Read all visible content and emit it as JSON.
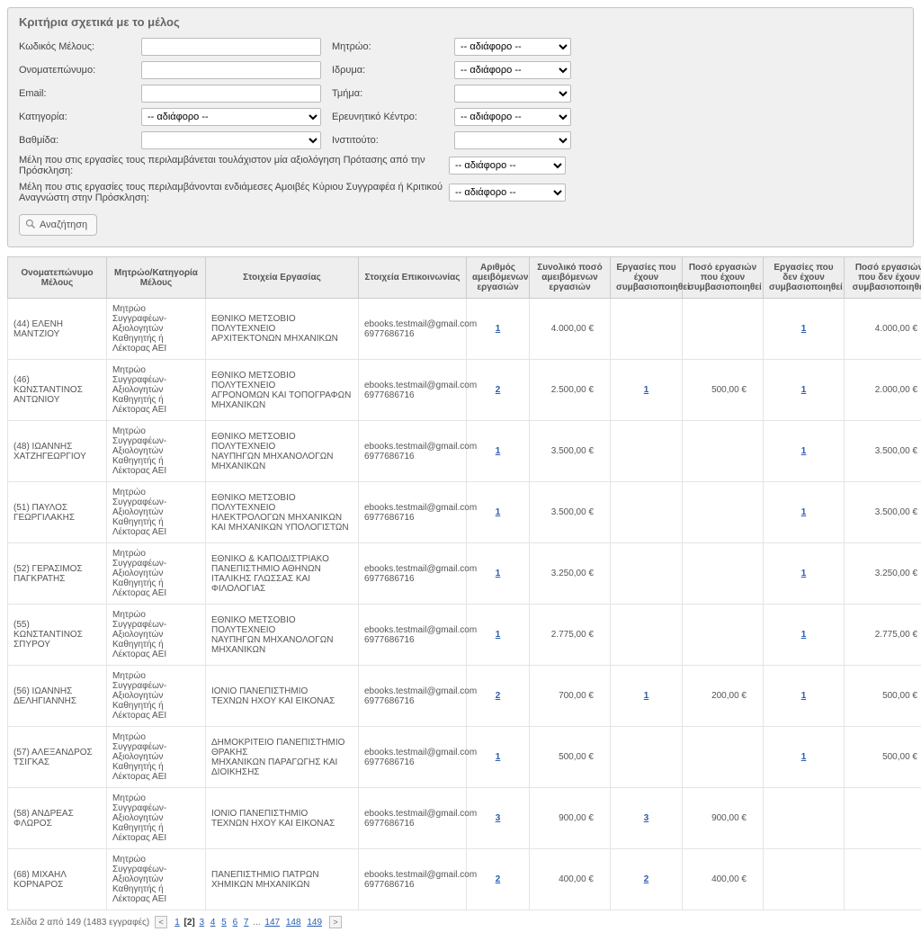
{
  "panel": {
    "title": "Κριτήρια σχετικά με το μέλος",
    "labels": {
      "member_code": "Κωδικός Μέλους:",
      "fullname": "Ονοματεπώνυμο:",
      "email": "Email:",
      "category": "Κατηγορία:",
      "rank": "Βαθμίδα:",
      "registry": "Μητρώο:",
      "institution": "Ιδρυμα:",
      "dept": "Τμήμα:",
      "research_center": "Ερευνητικό Κέντρο:",
      "institute": "Ινστιτούτο:",
      "long1": "Μέλη που στις εργασίες τους περιλαμβάνεται τουλάχιστον μία αξιολόγηση Πρότασης από την Πρόσκληση:",
      "long2": "Μέλη που στις εργασίες τους περιλαμβάνονται ενδιάμεσες Αμοιβές Κύριου Συγγραφέα ή Κριτικού Αναγνώστη στην Πρόσκληση:"
    },
    "ad": "-- αδιάφορο --",
    "search": "Αναζήτηση"
  },
  "headers": {
    "c1": "Ονοματεπώνυμο Μέλους",
    "c2": "Μητρώο/Κατηγορία Μέλους",
    "c3": "Στοιχεία Εργασίας",
    "c4": "Στοιχεία Επικοινωνίας",
    "c5": "Αριθμός αμειβόμενων εργασιών",
    "c6": "Συνολικό ποσό αμειβόμενων εργασιών",
    "c7": "Εργασίες που έχουν συμβασιοποιηθεί",
    "c8": "Ποσό εργασιών που έχουν συμβασιοποιηθεί",
    "c9": "Εργασίες που δεν έχουν συμβασιοποιηθεί",
    "c10": "Ποσό εργασιών που δεν έχουν συμβασιοποιηθεί"
  },
  "common": {
    "registry": "Μητρώο Συγγραφέων-Αξιολογητών",
    "cat": "Καθηγητής ή Λέκτορας ΑΕΙ",
    "email": "ebooks.testmail@gmail.com",
    "phone": "6977686716"
  },
  "rows": [
    {
      "name": "(44) ΕΛΕΝΗ ΜΑΝΤΖΙΟΥ",
      "work": "ΕΘΝΙΚΟ ΜΕΤΣΟΒΙΟ ΠΟΛΥΤΕΧΝΕΙΟ\nΑΡΧΙΤΕΚΤΟΝΩΝ ΜΗΧΑΝΙΚΩΝ",
      "count": "1",
      "total": "4.000,00 €",
      "done_c": "",
      "done_a": "",
      "und_c": "1",
      "und_a": "4.000,00 €"
    },
    {
      "name": "(46) ΚΩΝΣΤΑΝΤΙΝΟΣ ΑΝΤΩΝΙΟΥ",
      "work": "ΕΘΝΙΚΟ ΜΕΤΣΟΒΙΟ ΠΟΛΥΤΕΧΝΕΙΟ\nΑΓΡΟΝΟΜΩΝ ΚΑΙ ΤΟΠΟΓΡΑΦΩΝ ΜΗΧΑΝΙΚΩΝ",
      "count": "2",
      "total": "2.500,00 €",
      "done_c": "1",
      "done_a": "500,00 €",
      "und_c": "1",
      "und_a": "2.000,00 €"
    },
    {
      "name": "(48) ΙΩΑΝΝΗΣ ΧΑΤΖΗΓΕΩΡΓΙΟΥ",
      "work": "ΕΘΝΙΚΟ ΜΕΤΣΟΒΙΟ ΠΟΛΥΤΕΧΝΕΙΟ\nΝΑΥΠΗΓΩΝ ΜΗΧΑΝΟΛΟΓΩΝ ΜΗΧΑΝΙΚΩΝ",
      "count": "1",
      "total": "3.500,00 €",
      "done_c": "",
      "done_a": "",
      "und_c": "1",
      "und_a": "3.500,00 €"
    },
    {
      "name": "(51) ΠΑΥΛΟΣ ΓΕΩΡΓΙΛΑΚΗΣ",
      "work": "ΕΘΝΙΚΟ ΜΕΤΣΟΒΙΟ ΠΟΛΥΤΕΧΝΕΙΟ\nΗΛΕΚΤΡΟΛΟΓΩΝ ΜΗΧΑΝΙΚΩΝ ΚΑΙ ΜΗΧΑΝΙΚΩΝ ΥΠΟΛΟΓΙΣΤΩΝ",
      "count": "1",
      "total": "3.500,00 €",
      "done_c": "",
      "done_a": "",
      "und_c": "1",
      "und_a": "3.500,00 €"
    },
    {
      "name": "(52) ΓΕΡΑΣΙΜΟΣ ΠΑΓΚΡΑΤΗΣ",
      "work": "ΕΘΝΙΚΟ & ΚΑΠΟΔΙΣΤΡΙΑΚΟ ΠΑΝΕΠΙΣΤΗΜΙΟ ΑΘΗΝΩΝ\nΙΤΑΛΙΚΗΣ ΓΛΩΣΣΑΣ ΚΑΙ ΦΙΛΟΛΟΓΙΑΣ",
      "count": "1",
      "total": "3.250,00 €",
      "done_c": "",
      "done_a": "",
      "und_c": "1",
      "und_a": "3.250,00 €"
    },
    {
      "name": "(55) ΚΩΝΣΤΑΝΤΙΝΟΣ ΣΠΥΡΟΥ",
      "work": "ΕΘΝΙΚΟ ΜΕΤΣΟΒΙΟ ΠΟΛΥΤΕΧΝΕΙΟ\nΝΑΥΠΗΓΩΝ ΜΗΧΑΝΟΛΟΓΩΝ ΜΗΧΑΝΙΚΩΝ",
      "count": "1",
      "total": "2.775,00 €",
      "done_c": "",
      "done_a": "",
      "und_c": "1",
      "und_a": "2.775,00 €"
    },
    {
      "name": "(56) ΙΩΑΝΝΗΣ ΔΕΛΗΓΙΑΝΝΗΣ",
      "work": "ΙΟΝΙΟ ΠΑΝΕΠΙΣΤΗΜΙΟ\nΤΕΧΝΩΝ ΗΧΟΥ ΚΑΙ ΕΙΚΟΝΑΣ",
      "count": "2",
      "total": "700,00 €",
      "done_c": "1",
      "done_a": "200,00 €",
      "und_c": "1",
      "und_a": "500,00 €"
    },
    {
      "name": "(57) ΑΛΕΞΑΝΔΡΟΣ ΤΣΙΓΚΑΣ",
      "work": "ΔΗΜΟΚΡΙΤΕΙΟ ΠΑΝΕΠΙΣΤΗΜΙΟ ΘΡΑΚΗΣ\nΜΗΧΑΝΙΚΩΝ ΠΑΡΑΓΩΓΗΣ ΚΑΙ ΔΙΟΙΚΗΣΗΣ",
      "count": "1",
      "total": "500,00 €",
      "done_c": "",
      "done_a": "",
      "und_c": "1",
      "und_a": "500,00 €"
    },
    {
      "name": "(58) ΑΝΔΡΕΑΣ ΦΛΩΡΟΣ",
      "work": "ΙΟΝΙΟ ΠΑΝΕΠΙΣΤΗΜΙΟ\nΤΕΧΝΩΝ ΗΧΟΥ ΚΑΙ ΕΙΚΟΝΑΣ",
      "count": "3",
      "total": "900,00 €",
      "done_c": "3",
      "done_a": "900,00 €",
      "und_c": "",
      "und_a": ""
    },
    {
      "name": "(68) ΜΙΧΑΗΛ ΚΟΡΝΑΡΟΣ",
      "work": "ΠΑΝΕΠΙΣΤΗΜΙΟ ΠΑΤΡΩΝ\nΧΗΜΙΚΩΝ ΜΗΧΑΝΙΚΩΝ",
      "count": "2",
      "total": "400,00 €",
      "done_c": "2",
      "done_a": "400,00 €",
      "und_c": "",
      "und_a": ""
    }
  ],
  "pager": {
    "text": "Σελίδα 2 από 149 (1483 εγγραφές)",
    "pages": [
      "1",
      "[2]",
      "3",
      "4",
      "5",
      "6",
      "7",
      "...",
      "147",
      "148",
      "149"
    ]
  }
}
